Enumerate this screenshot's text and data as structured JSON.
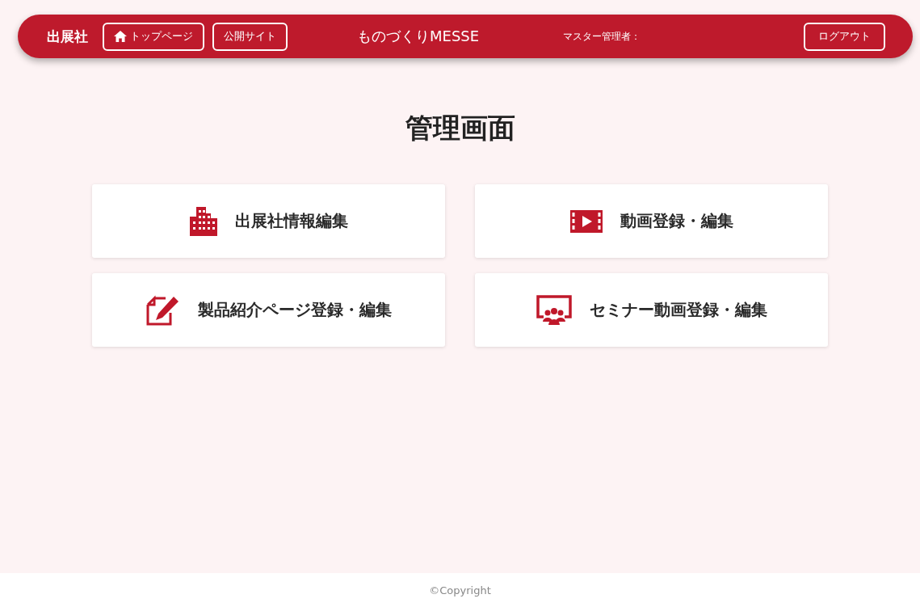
{
  "header": {
    "brand": "出展社",
    "buttons": [
      {
        "label": "トップページ",
        "kind": "home"
      },
      {
        "label": "公開サイト",
        "kind": "plain"
      }
    ],
    "title": "ものづくりMESSE",
    "user": "マスター管理者：",
    "logout": "ログアウト"
  },
  "page_title": "管理画面",
  "cards": [
    {
      "label": "出展社情報編集",
      "kind": "building"
    },
    {
      "label": "動画登録・編集",
      "kind": "video"
    },
    {
      "label": "製品紹介ページ登録・編集",
      "kind": "edit"
    },
    {
      "label": "セミナー動画登録・編集",
      "kind": "seminar"
    }
  ],
  "footer": "©Copyright"
}
